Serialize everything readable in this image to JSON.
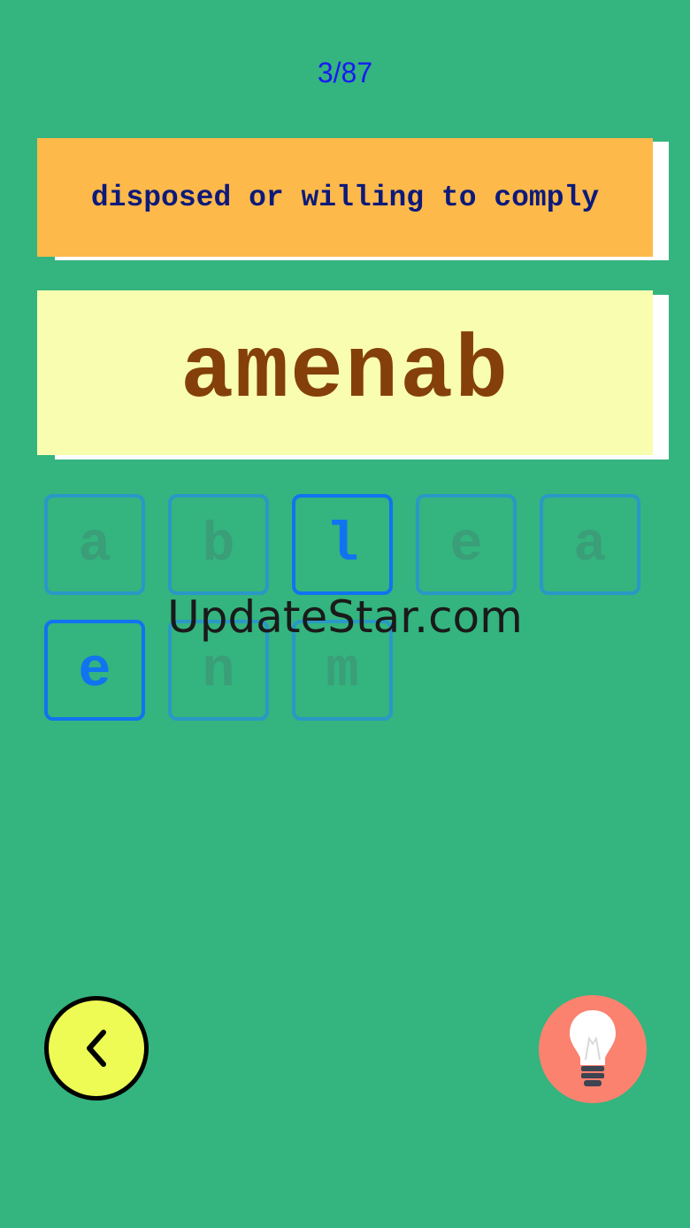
{
  "progress": {
    "current": "3/87"
  },
  "clue": {
    "text": "disposed or willing to comply"
  },
  "answer": {
    "text": "amenab"
  },
  "tiles": [
    {
      "letter": "a",
      "active": false
    },
    {
      "letter": "b",
      "active": false
    },
    {
      "letter": "l",
      "active": true
    },
    {
      "letter": "e",
      "active": false
    },
    {
      "letter": "a",
      "active": false
    },
    {
      "letter": "e",
      "active": true
    },
    {
      "letter": "n",
      "active": false
    },
    {
      "letter": "m",
      "active": false
    }
  ],
  "watermark": {
    "text": "UpdateStar.com"
  },
  "controls": {
    "back_icon": "chevron-left-icon",
    "hint_icon": "lightbulb-icon"
  },
  "colors": {
    "background": "#34b47f",
    "clue_card": "#fdb94a",
    "answer_card": "#f8fdaf",
    "answer_text": "#844008",
    "active_tile": "#1073f0",
    "back_button": "#eefb55",
    "hint_button": "#fb826f"
  }
}
